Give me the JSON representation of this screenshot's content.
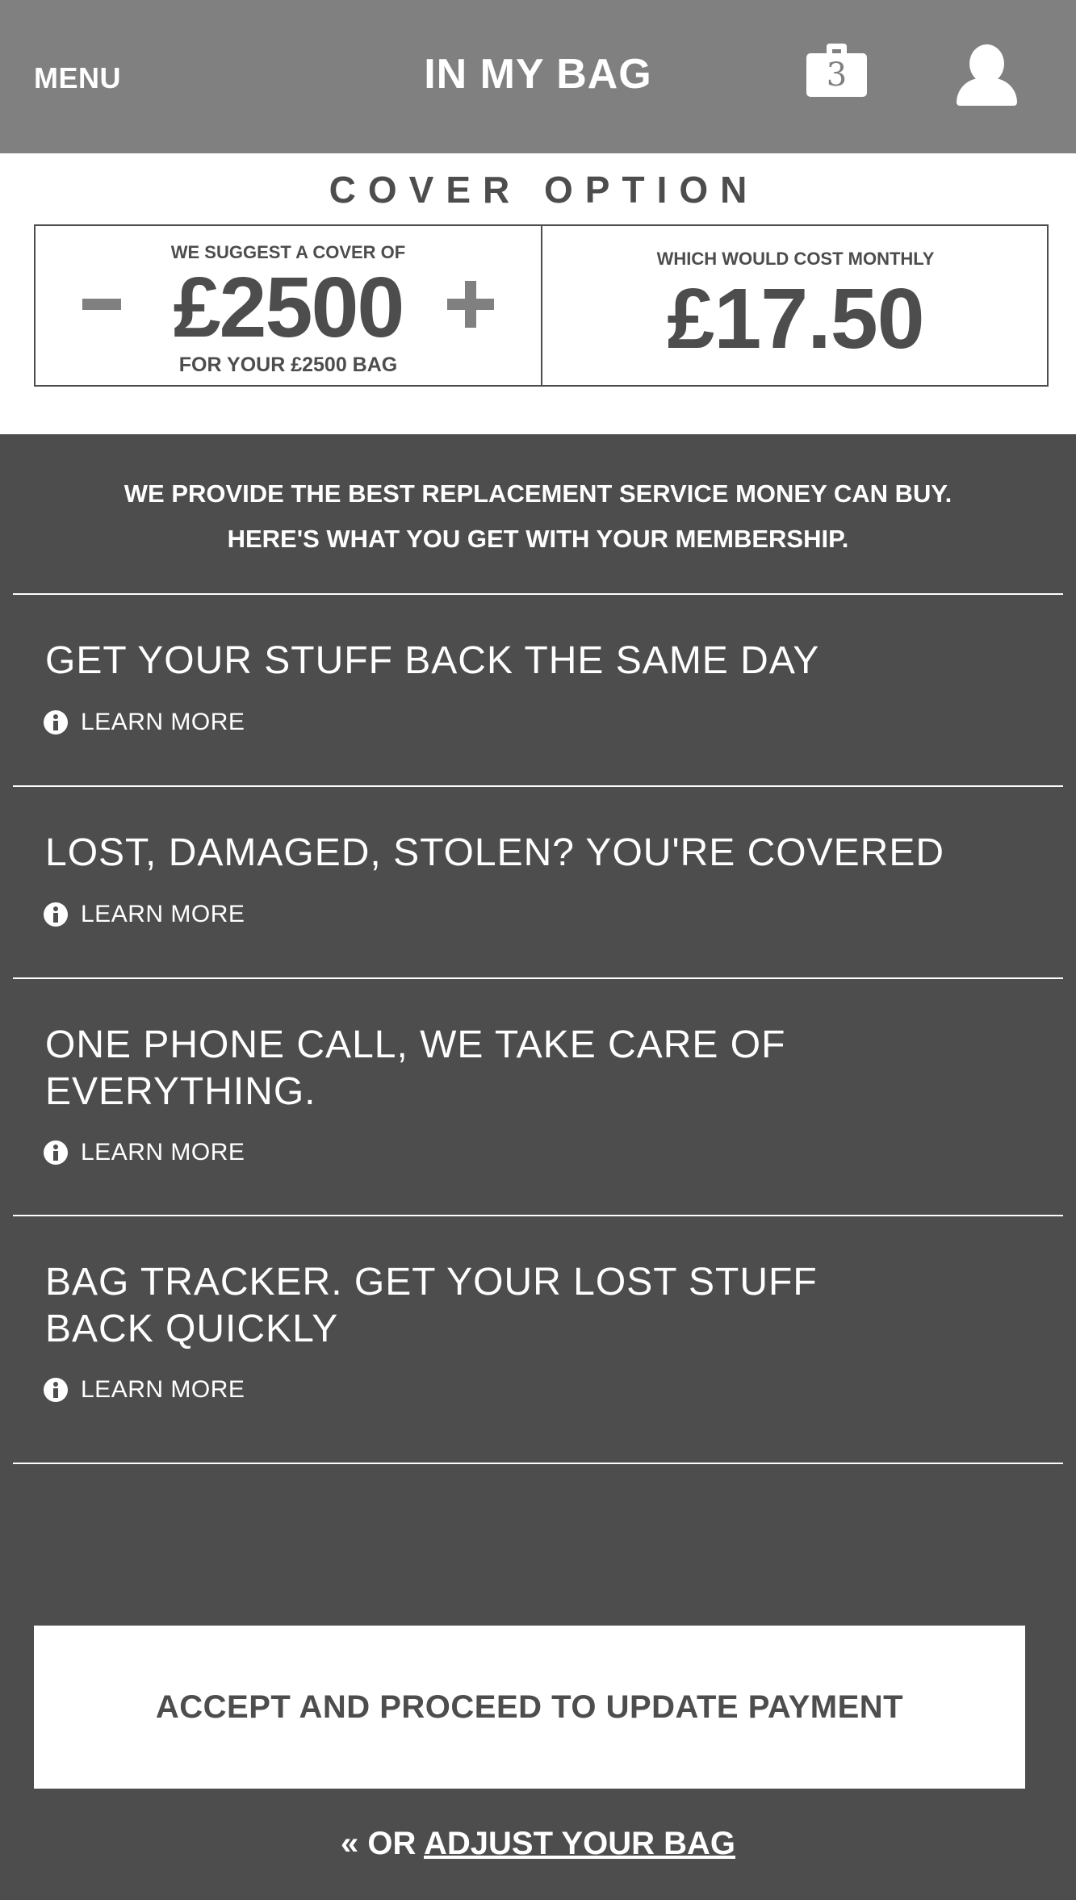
{
  "header": {
    "menu_label": "MENU",
    "title": "IN MY BAG",
    "bag_count": "3",
    "bag_icon": "shopping-bag-icon",
    "user_icon": "user-icon"
  },
  "cover": {
    "title": "COVER OPTION",
    "suggest_label": "WE SUGGEST A COVER OF",
    "amount": "£2500",
    "bag_value_label": "FOR YOUR £2500 BAG",
    "minus_icon": "minus-icon",
    "plus_icon": "plus-icon",
    "cost_label": "WHICH WOULD COST MONTHLY",
    "cost_amount": "£17.50"
  },
  "benefits": {
    "intro_line1": "WE PROVIDE THE BEST REPLACEMENT SERVICE MONEY CAN BUY.",
    "intro_line2": "HERE'S WHAT YOU GET WITH YOUR MEMBERSHIP.",
    "learn_more_label": "LEARN MORE",
    "info_icon": "info-icon",
    "items": [
      {
        "title": "GET YOUR STUFF BACK THE SAME DAY"
      },
      {
        "title": "LOST, DAMAGED, STOLEN? YOU'RE COVERED"
      },
      {
        "title": "ONE PHONE CALL, WE TAKE CARE OF EVERYTHING."
      },
      {
        "title": "BAG TRACKER. GET YOUR LOST STUFF BACK QUICKLY"
      }
    ]
  },
  "actions": {
    "accept_label": "ACCEPT AND PROCEED TO UPDATE PAYMENT",
    "adjust_prefix": "« OR ",
    "adjust_link": "ADJUST YOUR BAG"
  },
  "colors": {
    "header_bg": "#808080",
    "body_bg": "#4d4d4d",
    "panel_bg": "#ffffff",
    "text_dark": "#4d4d4d",
    "text_light": "#ffffff"
  }
}
